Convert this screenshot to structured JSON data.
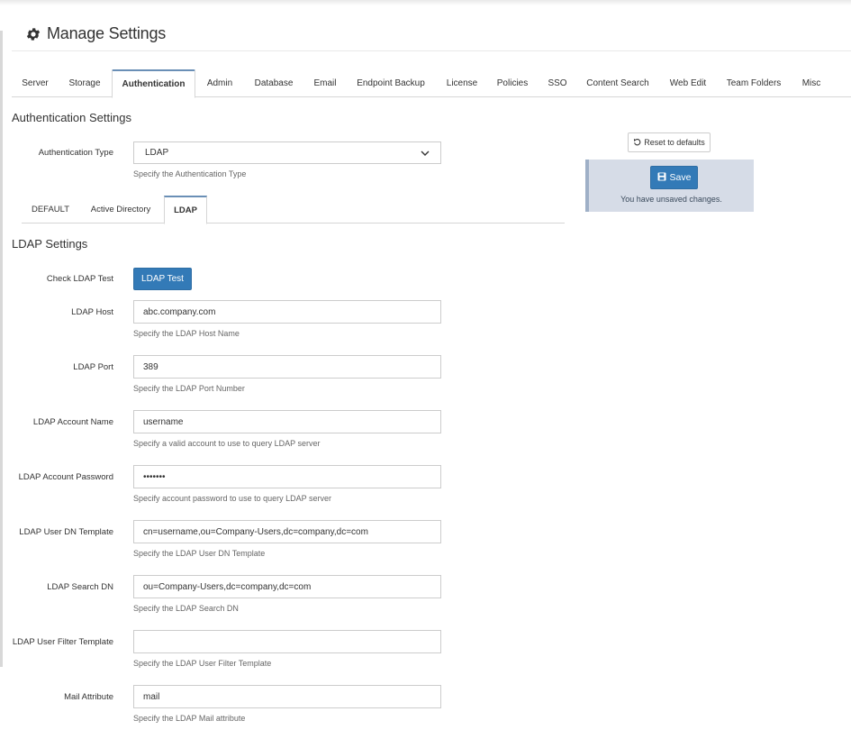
{
  "header": {
    "title": "Manage Settings",
    "icon": "gear-icon"
  },
  "main_tabs": [
    {
      "label": "Server"
    },
    {
      "label": "Storage"
    },
    {
      "label": "Authentication",
      "active": true
    },
    {
      "label": "Admin"
    },
    {
      "label": "Database"
    },
    {
      "label": "Email"
    },
    {
      "label": "Endpoint Backup"
    },
    {
      "label": "License"
    },
    {
      "label": "Policies"
    },
    {
      "label": "SSO"
    },
    {
      "label": "Content Search"
    },
    {
      "label": "Web Edit"
    },
    {
      "label": "Team Folders"
    },
    {
      "label": "Misc"
    }
  ],
  "auth": {
    "section_title": "Authentication Settings",
    "type_label": "Authentication Type",
    "type_value": "LDAP",
    "type_help": "Specify the Authentication Type"
  },
  "sub_tabs": [
    {
      "label": "DEFAULT"
    },
    {
      "label": "Active Directory"
    },
    {
      "label": "LDAP",
      "active": true
    }
  ],
  "ldap": {
    "section_title": "LDAP Settings",
    "check_label": "Check LDAP Test",
    "test_button": "LDAP Test",
    "fields": [
      {
        "label": "LDAP Host",
        "value": "abc.company.com",
        "help": "Specify the LDAP Host Name"
      },
      {
        "label": "LDAP Port",
        "value": "389",
        "help": "Specify the LDAP Port Number"
      },
      {
        "label": "LDAP Account Name",
        "value": "username",
        "help": "Specify a valid account to use to query LDAP server"
      },
      {
        "label": "LDAP Account Password",
        "value": "•••••••",
        "help": "Specify account password to use to query LDAP server"
      },
      {
        "label": "LDAP User DN Template",
        "value": "cn=username,ou=Company-Users,dc=company,dc=com",
        "help": "Specify the LDAP User DN Template"
      },
      {
        "label": "LDAP Search DN",
        "value": "ou=Company-Users,dc=company,dc=com",
        "help": "Specify the LDAP Search DN"
      },
      {
        "label": "LDAP User Filter Template",
        "value": "",
        "help": "Specify the LDAP User Filter Template"
      },
      {
        "label": "Mail Attribute",
        "value": "mail",
        "help": "Specify the LDAP Mail attribute"
      }
    ]
  },
  "actions": {
    "reset_label": "Reset to defaults",
    "save_label": "Save",
    "unsaved_text": "You have unsaved changes."
  },
  "colors": {
    "primary": "#337ab7",
    "panel": "#d6dce7",
    "active_tab_border": "#6a8fb6"
  }
}
